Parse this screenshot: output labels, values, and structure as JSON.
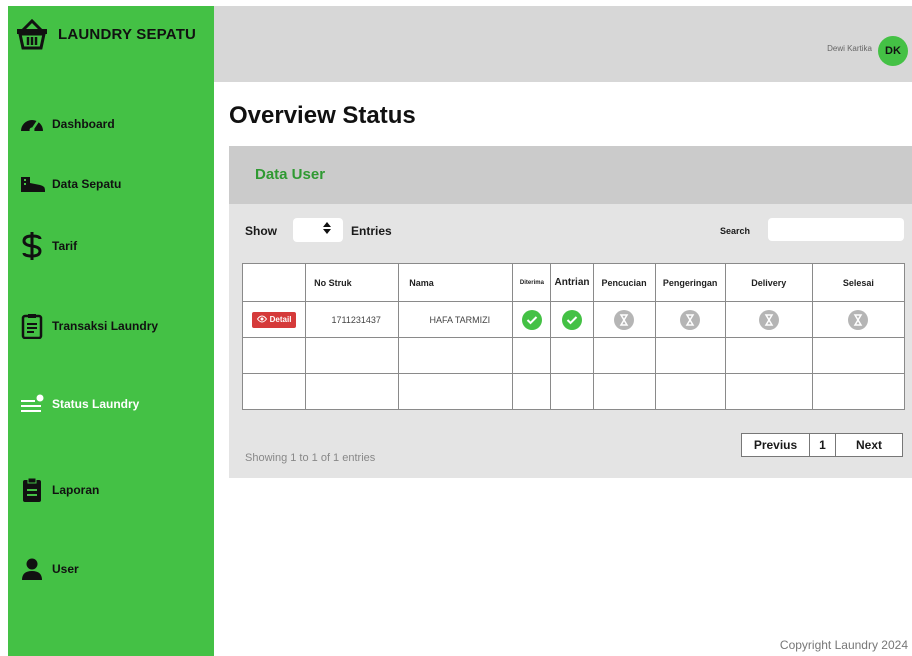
{
  "brand": {
    "title": "LAUNDRY SEPATU",
    "icon": "basket-icon"
  },
  "nav": [
    {
      "label": "Dashboard",
      "icon": "dashboard-gauge-icon"
    },
    {
      "label": "Data Sepatu",
      "icon": "shoe-icon"
    },
    {
      "label": "Tarif",
      "icon": "dollar-icon"
    },
    {
      "label": "Transaksi Laundry",
      "icon": "clipboard-icon"
    },
    {
      "label": "Status Laundry",
      "icon": "list-status-icon",
      "active": true
    },
    {
      "label": "Laporan",
      "icon": "report-icon"
    },
    {
      "label": "User",
      "icon": "user-icon"
    }
  ],
  "topbar": {
    "user_name": "Dewi Kartika",
    "avatar_initials": "DK"
  },
  "page_title": "Overview Status",
  "card": {
    "title": "Data User",
    "show_label": "Show",
    "entries_label": "Entries",
    "search_label": "Search",
    "search_value": ""
  },
  "table": {
    "headers": [
      "",
      "No Struk",
      "Nama",
      "Diterima",
      "Antrian",
      "Pencucian",
      "Pengeringan",
      "Delivery",
      "Selesai"
    ],
    "rows": [
      {
        "action": "Detail",
        "no_struk": "1711231437",
        "nama": "HAFA TARMIZI",
        "statuses": [
          "done",
          "done",
          "pending",
          "pending",
          "pending",
          "pending"
        ]
      }
    ]
  },
  "showing_text": "Showing 1 to 1 of 1 entries",
  "pagination": {
    "previous": "Previus",
    "page": "1",
    "next": "Next"
  },
  "footer": {
    "copyright": "Copyright Laundry 2024"
  },
  "colors": {
    "sidebar": "#44c145",
    "accent_text": "#2f9a32",
    "detail_button": "#d53a3a",
    "pending": "#b5b5b5"
  }
}
